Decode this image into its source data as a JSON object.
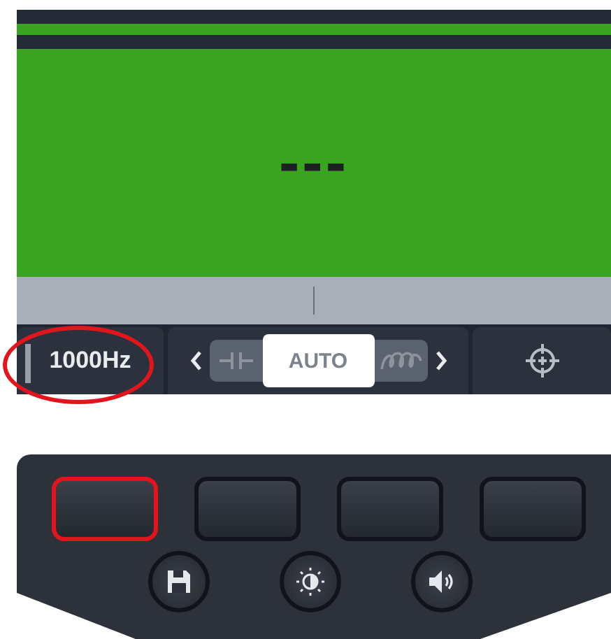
{
  "display": {
    "reading": "---"
  },
  "softkeys": [
    {
      "kind": "text",
      "label": "1000Hz",
      "highlighted": true
    },
    {
      "kind": "modes",
      "modes": [
        {
          "kind": "capacitor",
          "selected": false
        },
        {
          "kind": "auto",
          "label": "AUTO",
          "selected": true
        },
        {
          "kind": "inductor",
          "selected": false
        }
      ]
    },
    {
      "kind": "crosshair"
    }
  ],
  "panel_buttons": [
    {
      "selected": true
    },
    {
      "selected": false
    },
    {
      "selected": false
    },
    {
      "selected": false
    }
  ],
  "round_buttons": [
    {
      "kind": "save"
    },
    {
      "kind": "brightness"
    },
    {
      "kind": "sound"
    }
  ]
}
